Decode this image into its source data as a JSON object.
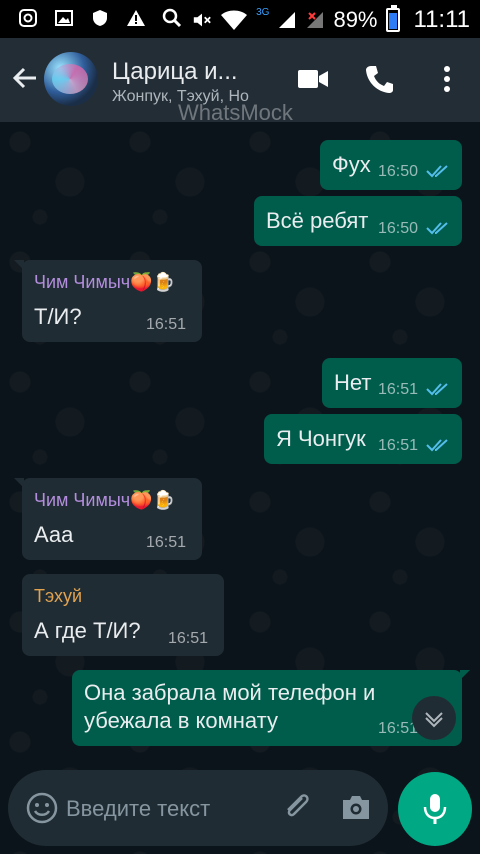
{
  "status_bar": {
    "battery": "89%",
    "time": "11:11",
    "network": "3G",
    "icons": [
      "instagram-icon",
      "image-icon",
      "shield-icon",
      "warning-icon",
      "search-icon",
      "mute-icon",
      "wifi-icon",
      "signal-icon",
      "battery-icon"
    ]
  },
  "header": {
    "title": "Царица и...",
    "subtitle": "Жонпук, Тэхуй, Но",
    "watermark": "WhatsMock"
  },
  "messages": [
    {
      "dir": "out",
      "text": "Фух",
      "time": "16:50"
    },
    {
      "dir": "out",
      "text": "Всё ребят",
      "time": "16:50"
    },
    {
      "dir": "in",
      "sender": "Чим Чимыч🍑🍺",
      "sender_color": "#b48ede",
      "text": "Т/И?",
      "time": "16:51"
    },
    {
      "dir": "out",
      "text": "Нет",
      "time": "16:51"
    },
    {
      "dir": "out",
      "text": "Я Чонгук",
      "time": "16:51"
    },
    {
      "dir": "in",
      "sender": "Чим Чимыч🍑🍺",
      "sender_color": "#b48ede",
      "text": "Ааа",
      "time": "16:51"
    },
    {
      "dir": "in",
      "sender": "Тэхуй",
      "sender_color": "#e1a350",
      "text": "А где Т/И?",
      "time": "16:51"
    },
    {
      "dir": "out",
      "text_line1": "Она забрала мой телефон и",
      "text_line2": "убежала в комнату",
      "time": "16:51"
    }
  ],
  "input": {
    "placeholder": "Введите текст"
  },
  "colors": {
    "outgoing": "#005c4b",
    "incoming": "#202c33",
    "accent": "#00a884",
    "read_ticks": "#53bdeb"
  }
}
